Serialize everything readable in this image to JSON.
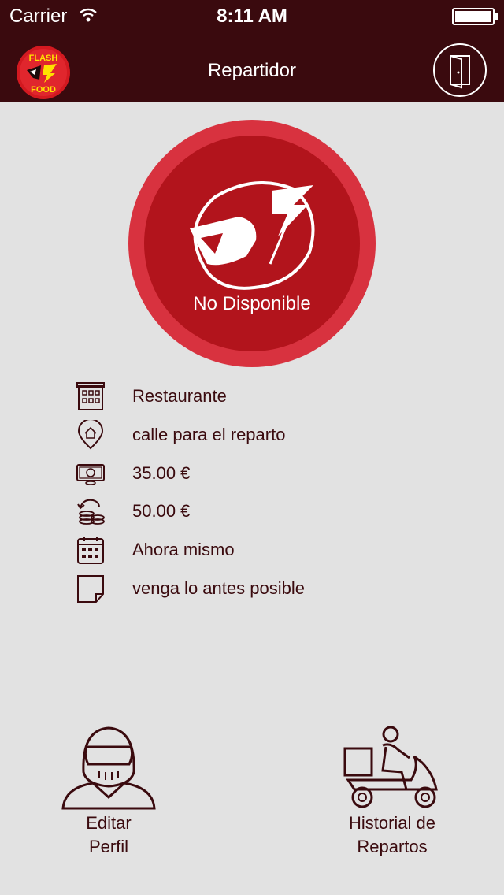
{
  "status_bar": {
    "carrier": "Carrier",
    "time": "8:11 AM"
  },
  "header": {
    "title": "Repartidor",
    "logo_line1": "FLASH",
    "logo_line2": "FOOD"
  },
  "availability": {
    "label": "No Disponible"
  },
  "order_info": [
    {
      "icon": "building-icon",
      "text": "Restaurante"
    },
    {
      "icon": "location-pin-icon",
      "text": "calle para el reparto"
    },
    {
      "icon": "money-icon",
      "text": "35.00 €"
    },
    {
      "icon": "coins-change-icon",
      "text": "50.00 €"
    },
    {
      "icon": "calendar-icon",
      "text": "Ahora mismo"
    },
    {
      "icon": "note-icon",
      "text": "venga lo antes posible"
    }
  ],
  "bottom_nav": {
    "edit_profile": {
      "line1": "Editar",
      "line2": "Perfil"
    },
    "history": {
      "line1": "Historial de",
      "line2": "Repartos"
    }
  },
  "colors": {
    "header_bg": "#3a0a0e",
    "accent_red": "#b2141c",
    "ring_red": "#d8323f",
    "page_bg": "#e2e2e2",
    "text_dark": "#3a0a0e"
  }
}
